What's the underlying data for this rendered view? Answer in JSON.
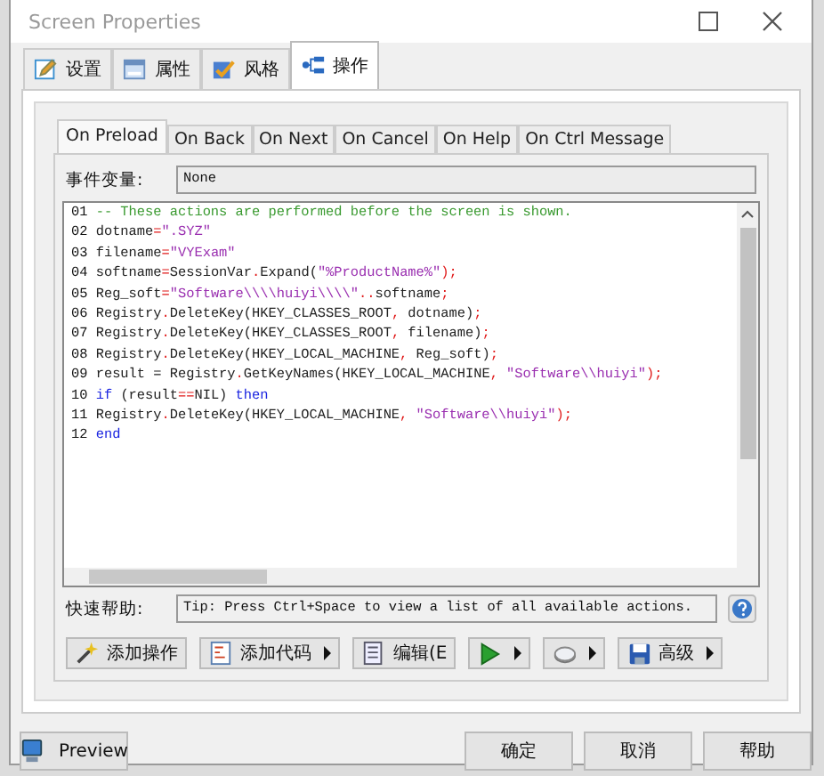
{
  "window": {
    "title": "Screen Properties"
  },
  "tabs": [
    {
      "label": "设置",
      "selected": false
    },
    {
      "label": "属性",
      "selected": false
    },
    {
      "label": "风格",
      "selected": false
    },
    {
      "label": "操作",
      "selected": true
    }
  ],
  "event_tabs": [
    {
      "label": "On Preload",
      "selected": true
    },
    {
      "label": "On Back",
      "selected": false
    },
    {
      "label": "On Next",
      "selected": false
    },
    {
      "label": "On Cancel",
      "selected": false
    },
    {
      "label": "On Help",
      "selected": false
    },
    {
      "label": "On Ctrl Message",
      "selected": false
    }
  ],
  "event_variable": {
    "label": "事件变量:",
    "value": "None"
  },
  "code_lines": [
    {
      "number": "01",
      "segments": [
        {
          "kind": "comment",
          "text": "-- These actions are performed before the screen is shown."
        }
      ]
    },
    {
      "number": "02",
      "segments": [
        {
          "kind": "plain",
          "text": "dotname"
        },
        {
          "kind": "op",
          "text": "="
        },
        {
          "kind": "string",
          "text": "\".SYZ\""
        }
      ]
    },
    {
      "number": "03",
      "segments": [
        {
          "kind": "plain",
          "text": "filename"
        },
        {
          "kind": "op",
          "text": "="
        },
        {
          "kind": "string",
          "text": "\"VYExam\""
        }
      ]
    },
    {
      "number": "04",
      "segments": [
        {
          "kind": "plain",
          "text": "softname"
        },
        {
          "kind": "op",
          "text": "="
        },
        {
          "kind": "plain",
          "text": "SessionVar"
        },
        {
          "kind": "op",
          "text": "."
        },
        {
          "kind": "plain",
          "text": "Expand("
        },
        {
          "kind": "string",
          "text": "\"%ProductName%\""
        },
        {
          "kind": "op",
          "text": ");"
        }
      ]
    },
    {
      "number": "05",
      "segments": [
        {
          "kind": "plain",
          "text": "Reg_soft"
        },
        {
          "kind": "op",
          "text": "="
        },
        {
          "kind": "string",
          "text": "\"Software\\\\\\\\huiyi\\\\\\\\\""
        },
        {
          "kind": "op",
          "text": ".."
        },
        {
          "kind": "plain",
          "text": "softname"
        },
        {
          "kind": "op",
          "text": ";"
        }
      ]
    },
    {
      "number": "06",
      "segments": [
        {
          "kind": "plain",
          "text": "Registry"
        },
        {
          "kind": "op",
          "text": "."
        },
        {
          "kind": "plain",
          "text": "DeleteKey(HKEY_CLASSES_ROOT"
        },
        {
          "kind": "op",
          "text": ","
        },
        {
          "kind": "plain",
          "text": " dotname)"
        },
        {
          "kind": "op",
          "text": ";"
        }
      ]
    },
    {
      "number": "07",
      "segments": [
        {
          "kind": "plain",
          "text": "Registry"
        },
        {
          "kind": "op",
          "text": "."
        },
        {
          "kind": "plain",
          "text": "DeleteKey(HKEY_CLASSES_ROOT"
        },
        {
          "kind": "op",
          "text": ","
        },
        {
          "kind": "plain",
          "text": " filename)"
        },
        {
          "kind": "op",
          "text": ";"
        }
      ]
    },
    {
      "number": "08",
      "segments": [
        {
          "kind": "plain",
          "text": "Registry"
        },
        {
          "kind": "op",
          "text": "."
        },
        {
          "kind": "plain",
          "text": "DeleteKey(HKEY_LOCAL_MACHINE"
        },
        {
          "kind": "op",
          "text": ","
        },
        {
          "kind": "plain",
          "text": " Reg_soft)"
        },
        {
          "kind": "op",
          "text": ";"
        }
      ]
    },
    {
      "number": "09",
      "segments": [
        {
          "kind": "plain",
          "text": "result = Registry"
        },
        {
          "kind": "op",
          "text": "."
        },
        {
          "kind": "plain",
          "text": "GetKeyNames(HKEY_LOCAL_MACHINE"
        },
        {
          "kind": "op",
          "text": ", "
        },
        {
          "kind": "string",
          "text": "\"Software\\\\huiyi\""
        },
        {
          "kind": "op",
          "text": ");"
        }
      ]
    },
    {
      "number": "10",
      "segments": [
        {
          "kind": "keyword",
          "text": "if"
        },
        {
          "kind": "plain",
          "text": " (result"
        },
        {
          "kind": "op",
          "text": "=="
        },
        {
          "kind": "plain",
          "text": "NIL) "
        },
        {
          "kind": "keyword",
          "text": "then"
        }
      ]
    },
    {
      "number": "11",
      "segments": [
        {
          "kind": "plain",
          "text": "Registry"
        },
        {
          "kind": "op",
          "text": "."
        },
        {
          "kind": "plain",
          "text": "DeleteKey(HKEY_LOCAL_MACHINE"
        },
        {
          "kind": "op",
          "text": ", "
        },
        {
          "kind": "string",
          "text": "\"Software\\\\huiyi\""
        },
        {
          "kind": "op",
          "text": ");"
        }
      ]
    },
    {
      "number": "12",
      "segments": [
        {
          "kind": "keyword",
          "text": "end"
        }
      ]
    }
  ],
  "quick_help": {
    "label": "快速帮助:",
    "value": "Tip: Press Ctrl+Space to view a list of all available actions."
  },
  "tool_buttons": [
    {
      "label": "添加操作",
      "dropdown": false
    },
    {
      "label": "添加代码",
      "dropdown": true
    },
    {
      "label": "编辑(E",
      "dropdown": false
    },
    {
      "dropdown": true
    },
    {
      "dropdown": true
    },
    {
      "label": "高级",
      "dropdown": true
    }
  ],
  "preview_button": {
    "label": "Preview"
  },
  "buttons": [
    {
      "label": "确定"
    },
    {
      "label": "取消"
    },
    {
      "label": "帮助"
    }
  ]
}
